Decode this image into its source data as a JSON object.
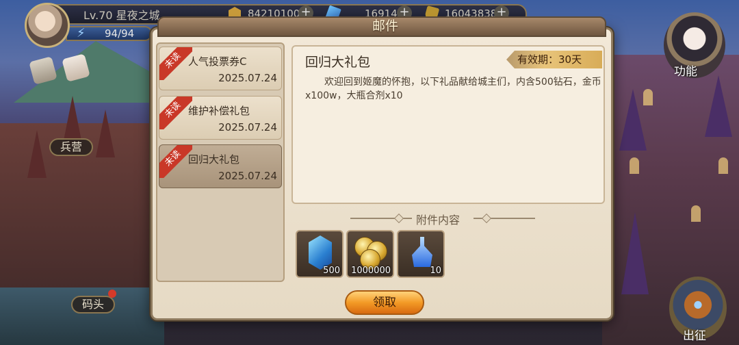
{
  "player": {
    "level_text": "Lv.70 星夜之城",
    "energy": "94/94"
  },
  "resources": [
    {
      "icon": "gold-hex-icon",
      "value": "84210100"
    },
    {
      "icon": "blue-gem-icon",
      "value": "16914"
    },
    {
      "icon": "shield-token-icon",
      "value": "16043838"
    }
  ],
  "map": {
    "barracks_label": "兵营",
    "dock_label": "码头"
  },
  "side_menu": {
    "function_label": "功能",
    "expedition_label": "出征"
  },
  "mail": {
    "title": "邮件",
    "unread_tag": "未读",
    "list": [
      {
        "subject": "人气投票券C",
        "date": "2025.07.24"
      },
      {
        "subject": "维护补偿礼包",
        "date": "2025.07.24"
      },
      {
        "subject": "回归大礼包",
        "date": "2025.07.24",
        "selected": true
      }
    ],
    "selected": {
      "title": "回归大礼包",
      "validity": "有效期：30天",
      "body": "欢迎回到姬魔的怀抱，以下礼品献给城主们，内含500钻石，金币x100w，大瓶合剂x10"
    },
    "attachments_title": "附件内容",
    "attachments": [
      {
        "icon": "diamond-crystal-icon",
        "count": "500"
      },
      {
        "icon": "gold-coins-icon",
        "count": "1000000"
      },
      {
        "icon": "potion-flask-icon",
        "count": "10"
      }
    ],
    "claim_label": "领取"
  },
  "colors": {
    "accent_orange": "#f39a26",
    "unread_red": "#c93828",
    "validity_gold": "#e8c47a"
  }
}
